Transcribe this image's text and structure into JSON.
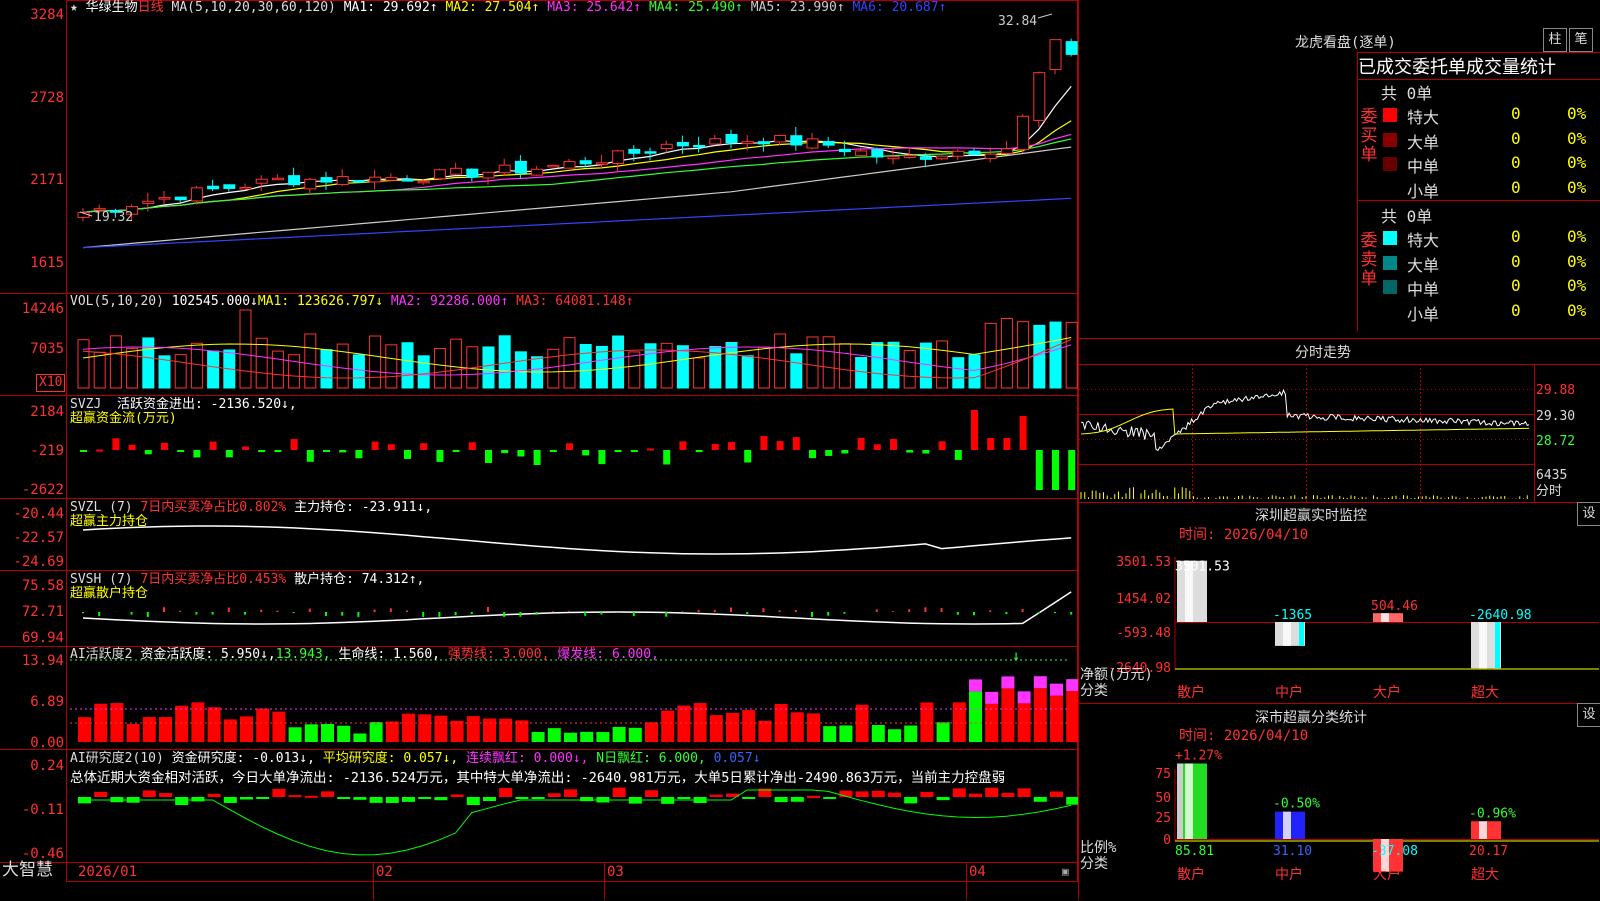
{
  "stock": {
    "name": "华绿生物",
    "period": "日线",
    "ma_header": "MA(5,10,20,30,60,120)",
    "ma": [
      {
        "text": "MA1: 29.692↑",
        "color": "#ffffff"
      },
      {
        "text": "MA2: 27.504↑",
        "color": "#ffff00"
      },
      {
        "text": "MA3: 25.642↑",
        "color": "#ff33ff"
      },
      {
        "text": "MA4: 25.490↑",
        "color": "#33ff33"
      },
      {
        "text": "MA5: 23.990↑",
        "color": "#cccccc"
      },
      {
        "text": "MA6: 20.687↑",
        "color": "#3344ff"
      }
    ],
    "high_label": "32.84",
    "low_label": "19.32",
    "y_ticks": [
      "3284",
      "2728",
      "2171",
      "1615"
    ]
  },
  "vol": {
    "header": "VOL(5,10,20)",
    "value": "102545.000↓",
    "ma": [
      {
        "text": "MA1: 123626.797↓",
        "color": "#ffff00"
      },
      {
        "text": "MA2: 92286.000↑",
        "color": "#ff33ff"
      },
      {
        "text": "MA3: 64081.148↑",
        "color": "#33ff33"
      }
    ],
    "y_ticks": [
      "14246",
      "7035"
    ],
    "unit": "X10"
  },
  "svzj": {
    "header": "SVZJ",
    "value": "活跃资金进出: -2136.520↓,",
    "sub": "超赢资金流(万元)",
    "y_ticks": [
      "2184",
      "-219",
      "-2622"
    ]
  },
  "svzl": {
    "header": "SVZL (7)",
    "extra": "7日内买卖净占比0.802%",
    "value": "主力持仓: -23.911↓,",
    "sub": "超赢主力持仓",
    "y_ticks": [
      "-20.44",
      "-22.57",
      "-24.69"
    ]
  },
  "svsh": {
    "header": "SVSH (7)",
    "extra": "7日内买卖净占比0.453%",
    "value": "散户持仓: 74.312↑,",
    "sub": "超赢散户持仓",
    "y_ticks": [
      "75.58",
      "72.71",
      "69.94"
    ]
  },
  "ai1": {
    "header": "AI活跃度2",
    "items": [
      {
        "text": "资金活跃度: 5.950↓,",
        "color": "#ffffff"
      },
      {
        "text": "13.943,",
        "color": "#33ff33"
      },
      {
        "text": "生命线: 1.560,",
        "color": "#ffffff"
      },
      {
        "text": "强势线: 3.000,",
        "color": "#ff3333"
      },
      {
        "text": "爆发线: 6.000,",
        "color": "#ff33ff"
      }
    ],
    "y_ticks": [
      "13.94",
      "6.89",
      "0.00"
    ]
  },
  "ai2": {
    "header": "AI研究度2(10)",
    "items": [
      {
        "text": "资金研究度: -0.013↓,",
        "color": "#ffffff"
      },
      {
        "text": "平均研究度: 0.057↓,",
        "color": "#ffff00"
      },
      {
        "text": "连续飘红: 0.000↓,",
        "color": "#ff33ff"
      },
      {
        "text": "N日飘红: 6.000,",
        "color": "#33ff33"
      },
      {
        "text": "0.057↓",
        "color": "#3366ff"
      }
    ],
    "summary": "总体近期大资金相对活跃，今日大单净流出: -2136.524万元，其中特大单净流出: -2640.981万元，大单5日累计净出-2490.863万元，当前主力控盘弱",
    "y_ticks": [
      "0.24",
      "-0.11",
      "-0.46"
    ]
  },
  "bottom": {
    "brand": "大智慧",
    "dates": [
      "2026/01",
      "02",
      "03",
      "04"
    ]
  },
  "dragon": {
    "title": "龙虎看盘(逐单)",
    "btn_col": "柱",
    "btn_pen": "笔",
    "tabs": [
      "已成交",
      "委托单",
      "成交量统计"
    ],
    "buy": {
      "label": "委买单",
      "total": "共 0单",
      "rows": [
        {
          "name": "特大",
          "count": "0",
          "pct": "0%",
          "color": "#ff0000"
        },
        {
          "name": "大单",
          "count": "0",
          "pct": "0%",
          "color": "#880000"
        },
        {
          "name": "中单",
          "count": "0",
          "pct": "0%",
          "color": "#660000"
        },
        {
          "name": "小单",
          "count": "0",
          "pct": "0%",
          "color": ""
        }
      ]
    },
    "sell": {
      "label": "委卖单",
      "total": "共 0单",
      "rows": [
        {
          "name": "特大",
          "count": "0",
          "pct": "0%",
          "color": "#00ffff"
        },
        {
          "name": "大单",
          "count": "0",
          "pct": "0%",
          "color": "#008888"
        },
        {
          "name": "中单",
          "count": "0",
          "pct": "0%",
          "color": "#006666"
        },
        {
          "name": "小单",
          "count": "0",
          "pct": "0%",
          "color": ""
        }
      ]
    }
  },
  "intraday": {
    "title": "分时走势",
    "right_labels": [
      "29.88",
      "29.30",
      "28.72",
      "6435",
      "分时"
    ]
  },
  "sz_monitor": {
    "title": "深圳超赢实时监控",
    "btn": "设",
    "time": "时间: 2026/04/10",
    "y_ticks": [
      "3501.53",
      "1454.02",
      "-593.48",
      "-2640.98"
    ],
    "unit": "净额(万元)",
    "cls": "分类",
    "cats": [
      "散户",
      "中户",
      "大户",
      "超大"
    ],
    "values": [
      3501.53,
      -1365,
      504.46,
      -2640.98
    ],
    "value_labels": [
      "3501.53",
      "-1365",
      "504.46",
      "-2640.98"
    ]
  },
  "sz_stats": {
    "title": "深市超赢分类统计",
    "btn": "设",
    "time": "时间: 2026/04/10",
    "y_ticks": [
      "75",
      "50",
      "25",
      "0"
    ],
    "unit": "比例%",
    "cls": "分类",
    "cats": [
      "散户",
      "中户",
      "大户",
      "超大"
    ],
    "values": [
      85.81,
      31.1,
      -37.08,
      20.17
    ],
    "value_labels": [
      "85.81",
      "31.10",
      "-37.08",
      "20.17"
    ],
    "pct_labels": [
      "+1.27%",
      "-0.50%",
      "",
      "-0.96%"
    ]
  }
}
